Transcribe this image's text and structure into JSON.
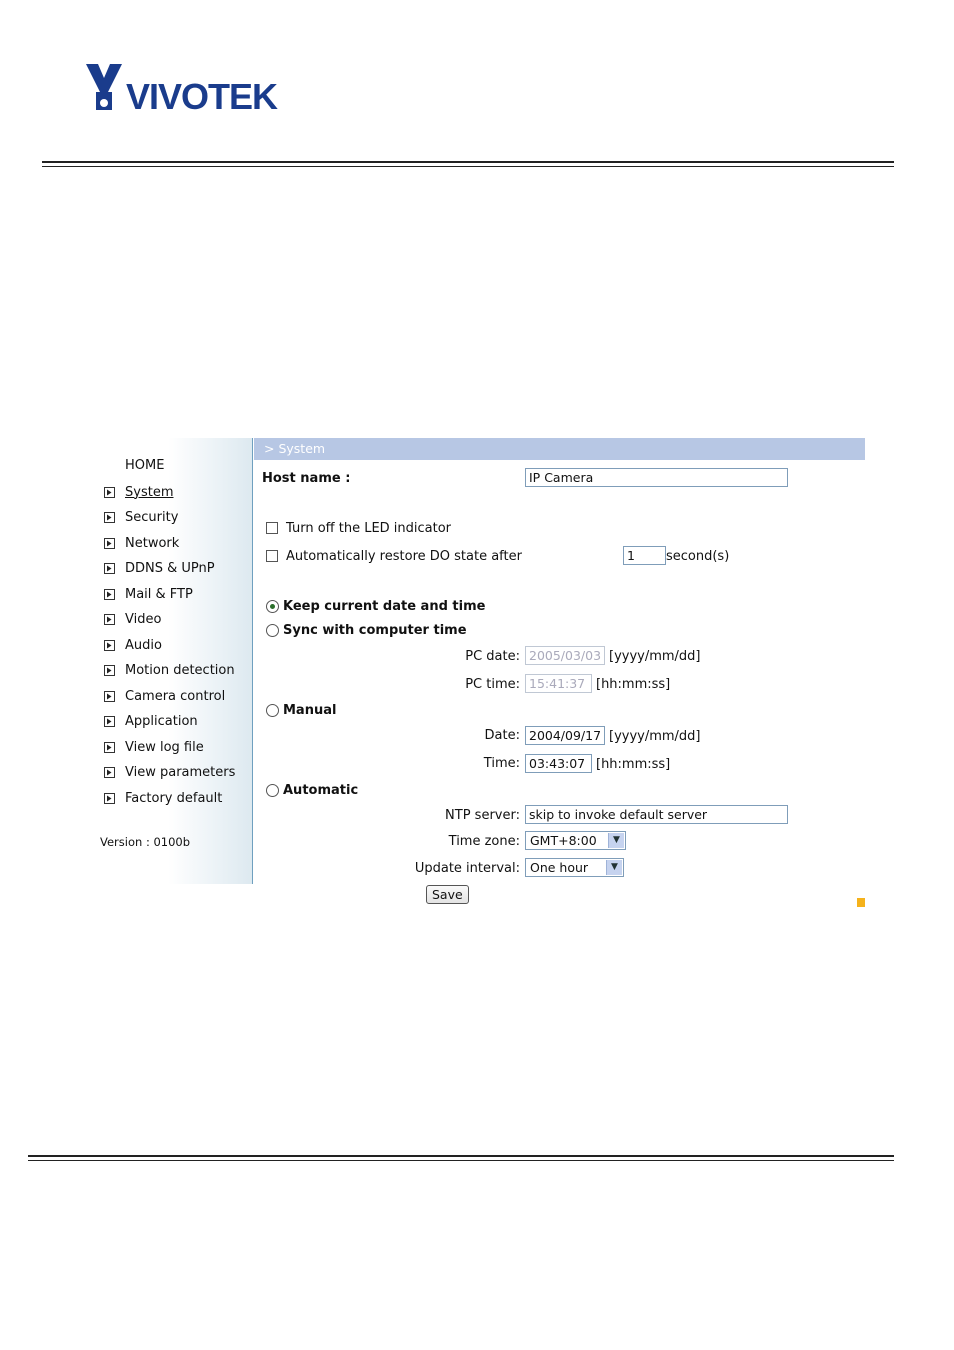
{
  "brand": {
    "logo_text": "VIVOTEK"
  },
  "sidebar": {
    "home_label": "HOME",
    "items": [
      {
        "label": "System",
        "icon": "arrow-right-icon",
        "active": true
      },
      {
        "label": "Security",
        "icon": "arrow-right-icon"
      },
      {
        "label": "Network",
        "icon": "arrow-right-icon"
      },
      {
        "label": "DDNS & UPnP",
        "icon": "arrow-right-icon"
      },
      {
        "label": "Mail & FTP",
        "icon": "arrow-right-icon"
      },
      {
        "label": "Video",
        "icon": "arrow-right-icon"
      },
      {
        "label": "Audio",
        "icon": "arrow-right-icon"
      },
      {
        "label": "Motion detection",
        "icon": "arrow-right-icon"
      },
      {
        "label": "Camera control",
        "icon": "arrow-right-icon"
      },
      {
        "label": "Application",
        "icon": "arrow-right-icon"
      },
      {
        "label": "View log file",
        "icon": "arrow-right-icon"
      },
      {
        "label": "View parameters",
        "icon": "arrow-right-icon"
      },
      {
        "label": "Factory default",
        "icon": "arrow-right-icon"
      }
    ],
    "version": "Version : 0100b"
  },
  "page": {
    "title": "> System",
    "host_name_label": "Host name :",
    "host_name_value": "IP Camera",
    "led_label": "Turn off the LED indicator",
    "do_label": "Automatically restore DO state after",
    "do_value": "1",
    "do_unit": "second(s)",
    "keep_label": "Keep current date and time",
    "sync_label": "Sync with computer time",
    "pc_date_label": "PC date:",
    "pc_date_value": "2005/03/03",
    "date_format": "[yyyy/mm/dd]",
    "pc_time_label": "PC time:",
    "pc_time_value": "15:41:37",
    "time_format": "[hh:mm:ss]",
    "manual_label": "Manual",
    "date_label": "Date:",
    "date_value": "2004/09/17",
    "time_label": "Time:",
    "time_value": "03:43:07",
    "automatic_label": "Automatic",
    "ntp_label": "NTP server:",
    "ntp_value": "skip to invoke default server",
    "tz_label": "Time zone:",
    "tz_value": "GMT+8:00",
    "interval_label": "Update interval:",
    "interval_value": "One hour",
    "save_label": "Save",
    "selected_time_option": "keep"
  },
  "colors": {
    "titlebar": "#b7c7e4",
    "accent": "#f5b21b",
    "sidebar_border": "#6fa0bf"
  }
}
